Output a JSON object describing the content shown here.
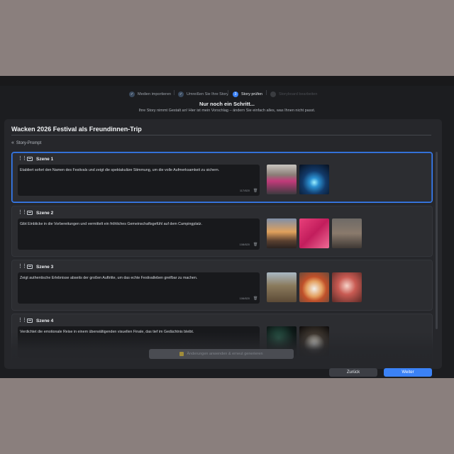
{
  "stepper": {
    "steps": [
      {
        "label": "Medien importieren",
        "state": "done",
        "marker": "✓"
      },
      {
        "label": "Umreißen Sie Ihre Story",
        "state": "done",
        "marker": "✓"
      },
      {
        "label": "Story prüfen",
        "state": "active",
        "marker": "3"
      },
      {
        "label": "Storyboard bearbeiten",
        "state": "upcoming",
        "marker": "4"
      }
    ]
  },
  "header": {
    "headline": "Nur noch ein Schritt...",
    "subline": "Ihre Story nimmt Gestalt an! Hier ist mein Vorschlag – ändern Sie einfach alles, was Ihnen nicht passt."
  },
  "panel": {
    "title": "Wacken 2026 Festival als Freundinnen-Trip",
    "prompt_link": "Story-Prompt"
  },
  "scenes": [
    {
      "title": "Szene 1",
      "text": "Etabliert sofort den Namen des Festivals und zeigt die spektakuläre Stimmung, um die volle Aufmerksamkeit zu sichern.",
      "counter": "117/820"
    },
    {
      "title": "Szene 2",
      "text": "Gibt Einblicke in die Vorbereitungen und vermittelt ein fröhliches Gemeinschaftsgefühl auf dem Campingplatz.",
      "counter": "108/820"
    },
    {
      "title": "Szene 3",
      "text": "Zeigt authentische Erlebnisse abseits der großen Auftritte, um das echte Festivalleben greifbar zu machen.",
      "counter": "106/820"
    },
    {
      "title": "Szene 4",
      "text": "Verdichtet die emotionale Reise in einem überwältigenden visuellen Finale, das tief im Gedächtnis bleibt.",
      "counter": ""
    }
  ],
  "apply_button": {
    "label": "Änderungen anwenden & erneut generieren"
  },
  "footer": {
    "back_label": "Zurück",
    "next_label": "Weiter"
  },
  "colors": {
    "accent": "#3b82f6",
    "background": "#1c1d20",
    "panel": "#26272b"
  }
}
